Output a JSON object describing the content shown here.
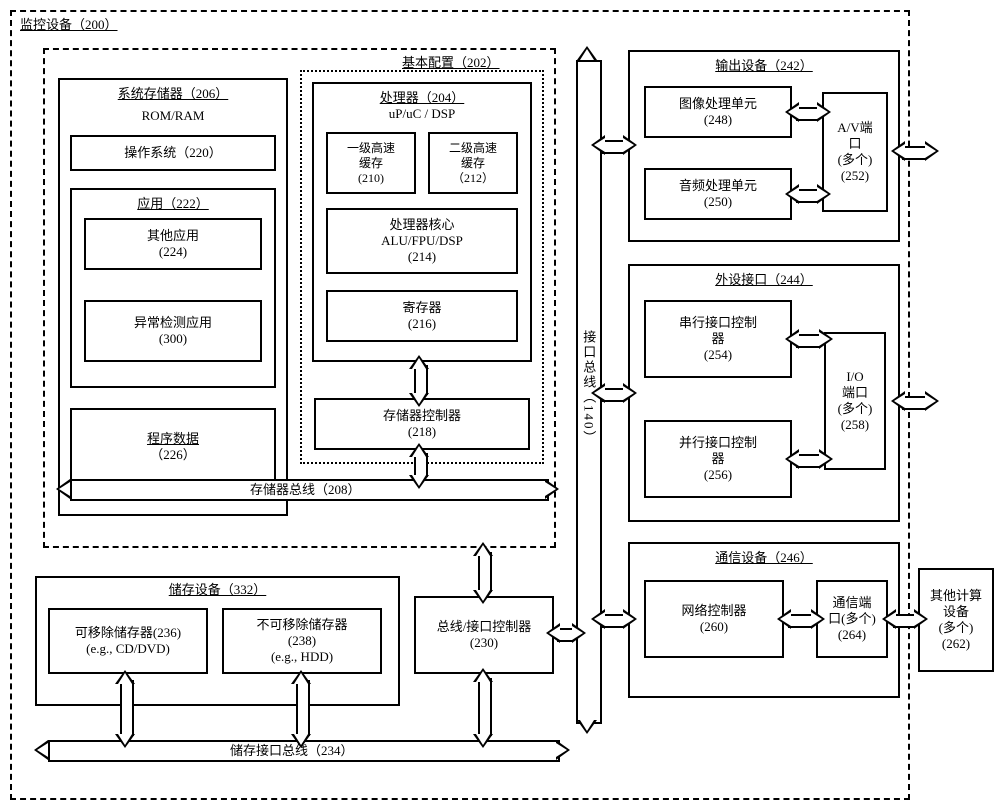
{
  "outer": {
    "title": "监控设备（200）"
  },
  "basicConfig": {
    "title": "基本配置（202）"
  },
  "sysMem": {
    "title": "系统存储器（206）",
    "romram": "ROM/RAM",
    "os": "操作系统（220）",
    "apps": "应用（222）",
    "otherApps_l1": "其他应用",
    "otherApps_l2": "(224)",
    "anomaly_l1": "异常检测应用",
    "anomaly_l2": "(300)",
    "progData_l1": "程序数据",
    "progData_l2": "（226）"
  },
  "proc": {
    "title": "处理器（204）",
    "subtitle": "uP/uC / DSP",
    "l1_l1": "一级高速",
    "l1_l2": "缓存",
    "l1_l3": "(210)",
    "l2_l1": "二级高速",
    "l2_l2": "缓存",
    "l2_l3": "（212）",
    "core_l1": "处理器核心",
    "core_l2": "ALU/FPU/DSP",
    "core_l3": "(214)",
    "reg_l1": "寄存器",
    "reg_l2": "(216)",
    "memctl_l1": "存储器控制器",
    "memctl_l2": "(218)"
  },
  "memBus": "存储器总线（208）",
  "ifBus": "接口总线（140）",
  "storage": {
    "title": "储存设备（332）",
    "rem_l1": "可移除储存器(236)",
    "rem_l2": "(e.g., CD/DVD)",
    "nonrem_l1": "不可移除储存器",
    "nonrem_l2": "(238)",
    "nonrem_l3": "(e.g., HDD)",
    "busctl_l1": "总线/接口控制器",
    "busctl_l2": "(230)",
    "storBus": "储存接口总线（234）"
  },
  "output": {
    "title": "输出设备（242）",
    "gpu_l1": "图像处理单元",
    "gpu_l2": "(248)",
    "apu_l1": "音频处理单元",
    "apu_l2": "(250)",
    "av_l1": "A/V端",
    "av_l2": "口",
    "av_l3": "(多个)",
    "av_l4": "(252)"
  },
  "periph": {
    "title": "外设接口（244）",
    "serial_l1": "串行接口控制",
    "serial_l2": "器",
    "serial_l3": "(254)",
    "parallel_l1": "并行接口控制",
    "parallel_l2": "器",
    "parallel_l3": "(256)",
    "io_l1": "I/O",
    "io_l2": "端口",
    "io_l3": "(多个)",
    "io_l4": "(258)"
  },
  "comm": {
    "title": "通信设备（246）",
    "net_l1": "网络控制器",
    "net_l2": "(260)",
    "port_l1": "通信端",
    "port_l2": "口(多个)",
    "port_l3": "(264)",
    "other_l1": "其他计算",
    "other_l2": "设备",
    "other_l3": "(多个)",
    "other_l4": "(262)"
  }
}
